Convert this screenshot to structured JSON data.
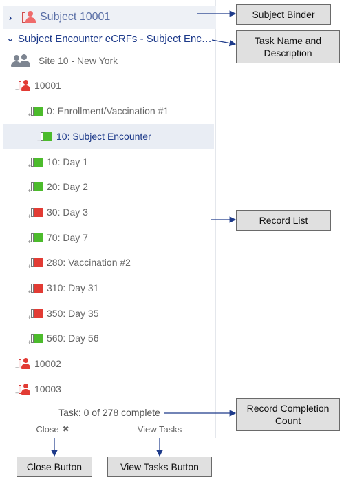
{
  "binder": {
    "label": "Subject 10001"
  },
  "task": {
    "label": "Subject Encounter eCRFs - Subject Encounter"
  },
  "site": {
    "label": "Site 10 - New York"
  },
  "tree": [
    {
      "label": "10001",
      "icon": "subject-icon",
      "status": "red"
    },
    {
      "label": "0: Enrollment/Vaccination #1",
      "icon": "record-icon",
      "status": "green"
    },
    {
      "label": "10: Subject Encounter",
      "icon": "record-icon",
      "status": "green"
    },
    {
      "label": "10: Day 1",
      "icon": "record-icon",
      "status": "green"
    },
    {
      "label": "20: Day 2",
      "icon": "record-icon",
      "status": "green"
    },
    {
      "label": "30: Day 3",
      "icon": "record-icon",
      "status": "red"
    },
    {
      "label": "70: Day 7",
      "icon": "record-icon",
      "status": "green"
    },
    {
      "label": "280: Vaccination #2",
      "icon": "record-icon",
      "status": "red"
    },
    {
      "label": "310: Day 31",
      "icon": "record-icon",
      "status": "red"
    },
    {
      "label": "350: Day 35",
      "icon": "record-icon",
      "status": "red"
    },
    {
      "label": "560: Day 56",
      "icon": "record-icon",
      "status": "green"
    },
    {
      "label": "10002",
      "icon": "subject-icon",
      "status": "red"
    },
    {
      "label": "10003",
      "icon": "subject-icon",
      "status": "red"
    }
  ],
  "footer": {
    "count": "Task: 0 of 278 complete",
    "close_label": "Close",
    "view_tasks_label": "View Tasks"
  },
  "callouts": {
    "subject_binder": "Subject Binder",
    "task_name": "Task Name and Description",
    "record_list": "Record List",
    "record_count": "Record Completion Count",
    "close_button": "Close Button",
    "view_tasks_button": "View Tasks Button"
  },
  "colors": {
    "accent": "#1d3a8a",
    "complete": "#4cbb2c",
    "incomplete": "#e23b34",
    "selected_bg": "#e9edf4"
  }
}
